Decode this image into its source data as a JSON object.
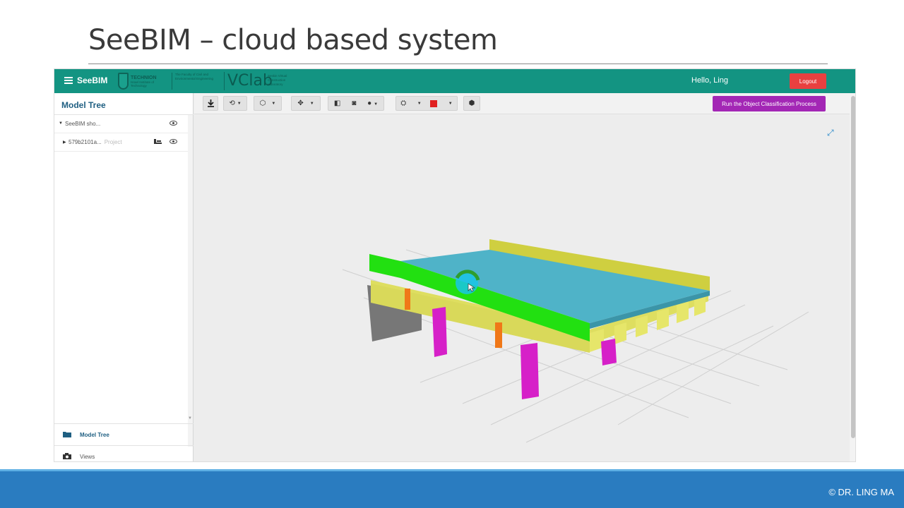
{
  "slide": {
    "title": "SeeBIM – cloud based system",
    "copyright": "© DR. LING MA"
  },
  "navbar": {
    "brand": "SeeBIM",
    "technion_logo_text": "TECHNION",
    "technion_logo_subtext": "Israel Institute of Technology",
    "faculty_text": "The Faculty of Civil and Environmental Engineering",
    "vclab_logo": "VClab",
    "vclab_subtext": "Seskin Virtual Construction Laboratory",
    "greeting": "Hello, Ling",
    "logout_label": "Logout"
  },
  "sidebar": {
    "title": "Model Tree",
    "tree": [
      {
        "label": "SeeBIM sho...",
        "sublabel": ""
      },
      {
        "label": "579b2101a...",
        "sublabel": "Project"
      }
    ],
    "tabs": [
      {
        "label": "Model Tree",
        "icon": "folder-icon",
        "active": true
      },
      {
        "label": "Views",
        "icon": "camera-icon",
        "active": false
      }
    ]
  },
  "toolbar": {
    "run_button_label": "Run the Object Classification Process",
    "tools": [
      "download-icon",
      "orbit-icon",
      "cube-view-icon",
      "pan-icon",
      "section-icon",
      "camera-icon",
      "explode-icon",
      "settings-icon",
      "color-swatch-icon",
      "object-info-icon"
    ],
    "accent_color": "#a327b5",
    "swatch_color": "#e02020"
  },
  "model_colors": {
    "deck": "#4fb3c8",
    "left_parapet": "#22e011",
    "right_parapet": "#d6d64a",
    "girders": "#dede60",
    "piers": "#d620c8",
    "bearings": "#f07818",
    "abutment": "#777777",
    "selection": "#19c4e8"
  }
}
